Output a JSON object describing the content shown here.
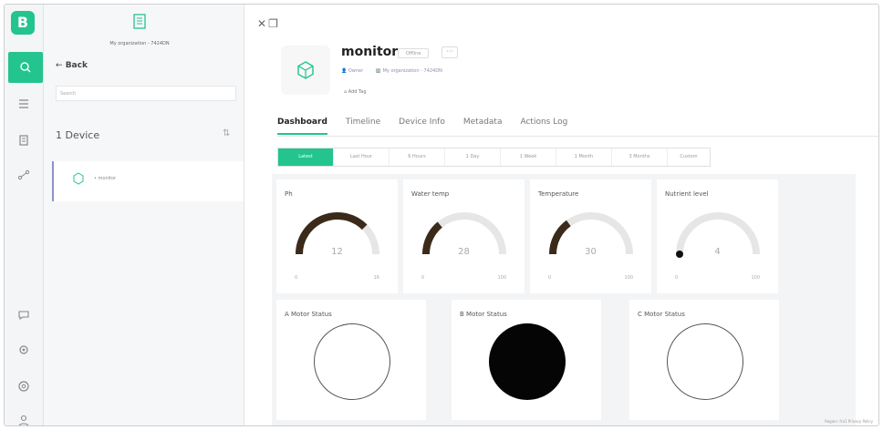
{
  "app": {
    "logo_letter": "B"
  },
  "rail": {
    "top_items": [
      "search-icon",
      "list-icon",
      "building-icon",
      "share-icon"
    ],
    "bottom_items": [
      "chat-icon",
      "settings-icon",
      "help-icon",
      "user-icon"
    ]
  },
  "panel": {
    "org_name": "My organization - 7424DN",
    "back_label": "Back",
    "search_placeholder": "Search",
    "device_count": "1 Device",
    "devices": [
      {
        "name": "monitor"
      }
    ]
  },
  "device": {
    "title": "monitor",
    "status": "Offline",
    "more": "···",
    "owner": "Owner",
    "organization": "My organization - 7424DN",
    "add_tag": "Add Tag"
  },
  "tabs": [
    "Dashboard",
    "Timeline",
    "Device Info",
    "Metadata",
    "Actions Log"
  ],
  "active_tab": 0,
  "ranges": [
    "Latest",
    "Last Hour",
    "6 Hours",
    "1 Day",
    "1 Week",
    "1 Month",
    "3 Months",
    "Custom"
  ],
  "active_range": 0,
  "gauges": [
    {
      "title": "Ph",
      "value": "12",
      "min": "0",
      "max": "16",
      "fraction": 0.75,
      "color": "#3b2a1a"
    },
    {
      "title": "Water temp",
      "value": "28",
      "min": "0",
      "max": "100",
      "fraction": 0.28,
      "color": "#3b2a1a"
    },
    {
      "title": "Temperature",
      "value": "30",
      "min": "0",
      "max": "100",
      "fraction": 0.3,
      "color": "#3b2a1a"
    },
    {
      "title": "Nutrient level",
      "value": "4",
      "min": "0",
      "max": "100",
      "fraction": 0.04,
      "color": "#111111"
    }
  ],
  "statuses": [
    {
      "title": "A Motor Status",
      "on": false
    },
    {
      "title": "B Motor Status",
      "on": true
    },
    {
      "title": "C Motor Status",
      "on": false
    }
  ],
  "colors": {
    "accent": "#23c48e",
    "track": "#e6e6e6",
    "led_on": "#050505"
  },
  "footer": "Region: fra1  Privacy Policy"
}
